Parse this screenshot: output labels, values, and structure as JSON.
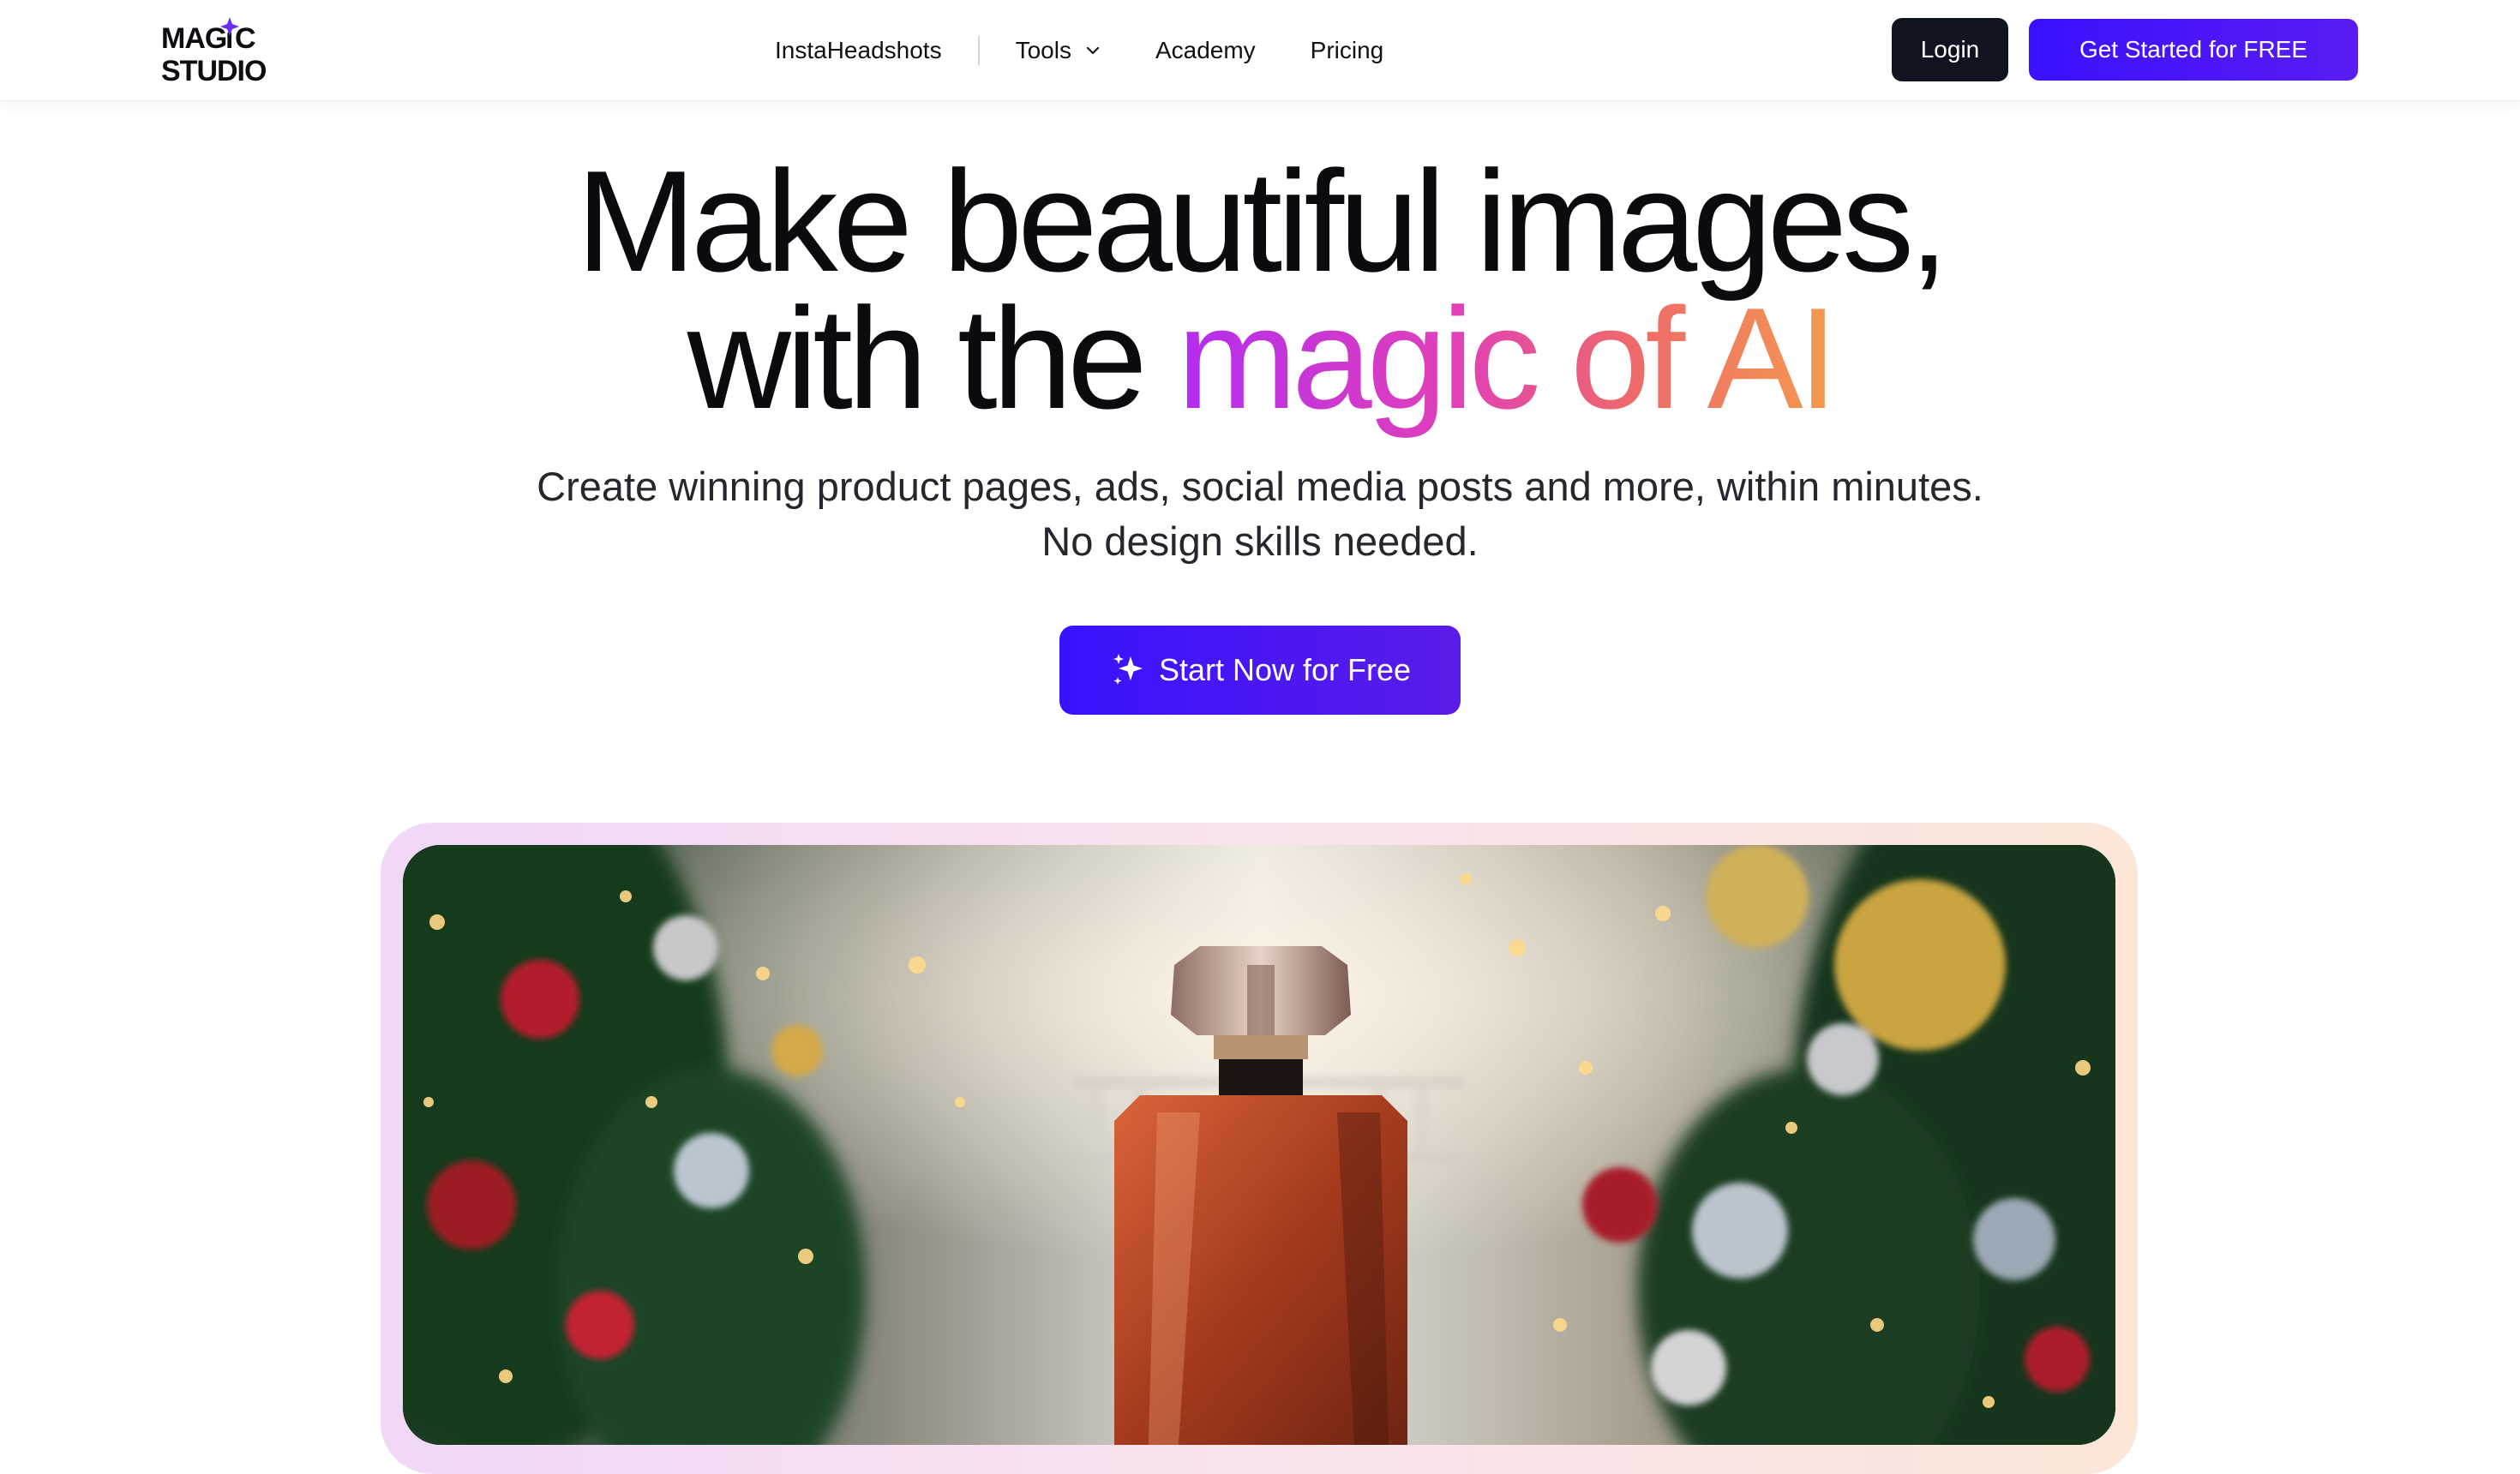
{
  "logo": {
    "line1": "MAGIC",
    "line2": "STUDIO"
  },
  "nav": {
    "links": [
      {
        "label": "InstaHeadshots"
      },
      {
        "label": "Tools"
      },
      {
        "label": "Academy"
      },
      {
        "label": "Pricing"
      }
    ],
    "login_label": "Login",
    "get_started_label": "Get Started for FREE"
  },
  "hero": {
    "title_line1": "Make beautiful images,",
    "title_line2_prefix": "with the ",
    "title_line2_highlight": "magic of AI",
    "subtitle_line1": "Create winning product pages, ads, social media posts and more, within minutes.",
    "subtitle_line2": "No design skills needed.",
    "cta_label": "Start Now for Free"
  },
  "icons": {
    "logo_star": "sparkle-icon",
    "tools_dropdown": "chevron-down-icon",
    "cta": "sparkles-icon"
  },
  "colors": {
    "primary": "#3b10ff",
    "dark_button": "#0f1420",
    "gradient_start": "#b32df0",
    "gradient_mid": "#e040b8",
    "gradient_end": "#f39a4e"
  }
}
